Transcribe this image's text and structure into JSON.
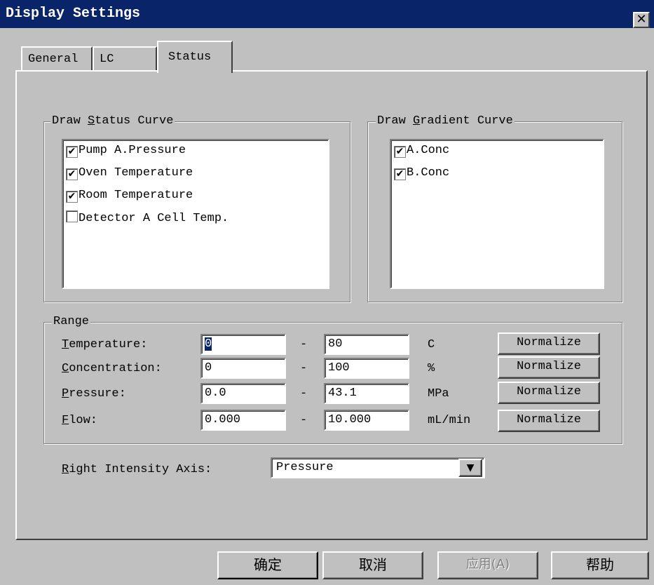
{
  "window": {
    "title": "Display Settings",
    "close_glyph": "✕"
  },
  "tabs": [
    {
      "label": "General"
    },
    {
      "label": "LC"
    },
    {
      "label": "Status",
      "selected": true
    }
  ],
  "status_curve": {
    "legend_pre": "Draw ",
    "legend_u": "S",
    "legend_post": "tatus Curve",
    "items": [
      {
        "label": "Pump A.Pressure",
        "checked": true
      },
      {
        "label": "Oven Temperature",
        "checked": true
      },
      {
        "label": "Room Temperature",
        "checked": true
      },
      {
        "label": "Detector A  Cell Temp.",
        "checked": false
      }
    ]
  },
  "gradient_curve": {
    "legend_pre": "Draw ",
    "legend_u": "G",
    "legend_post": "radient Curve",
    "items": [
      {
        "label": "A.Conc",
        "checked": true
      },
      {
        "label": "B.Conc",
        "checked": true
      }
    ]
  },
  "range": {
    "legend": "Range",
    "dash": "-",
    "rows": [
      {
        "label_u": "T",
        "label_rest": "emperature:",
        "min": "0",
        "max": "80",
        "unit": "C",
        "button": "Normalize"
      },
      {
        "label_u": "C",
        "label_rest": "oncentration:",
        "min": "0",
        "max": "100",
        "unit": "%",
        "button": "Normalize"
      },
      {
        "label_u": "P",
        "label_rest": "ressure:",
        "min": "0.0",
        "max": "43.1",
        "unit": "MPa",
        "button": "Normalize"
      },
      {
        "label_u": "F",
        "label_rest": "low:",
        "min": "0.000",
        "max": "10.000",
        "unit": "mL/min",
        "button": "Normalize"
      }
    ]
  },
  "right_axis": {
    "label_u": "R",
    "label_rest": "ight Intensity Axis:",
    "value": "Pressure",
    "arrow": "▼"
  },
  "footer": {
    "ok": "确定",
    "cancel": "取消",
    "apply": "应用(A)",
    "help": "帮助"
  }
}
